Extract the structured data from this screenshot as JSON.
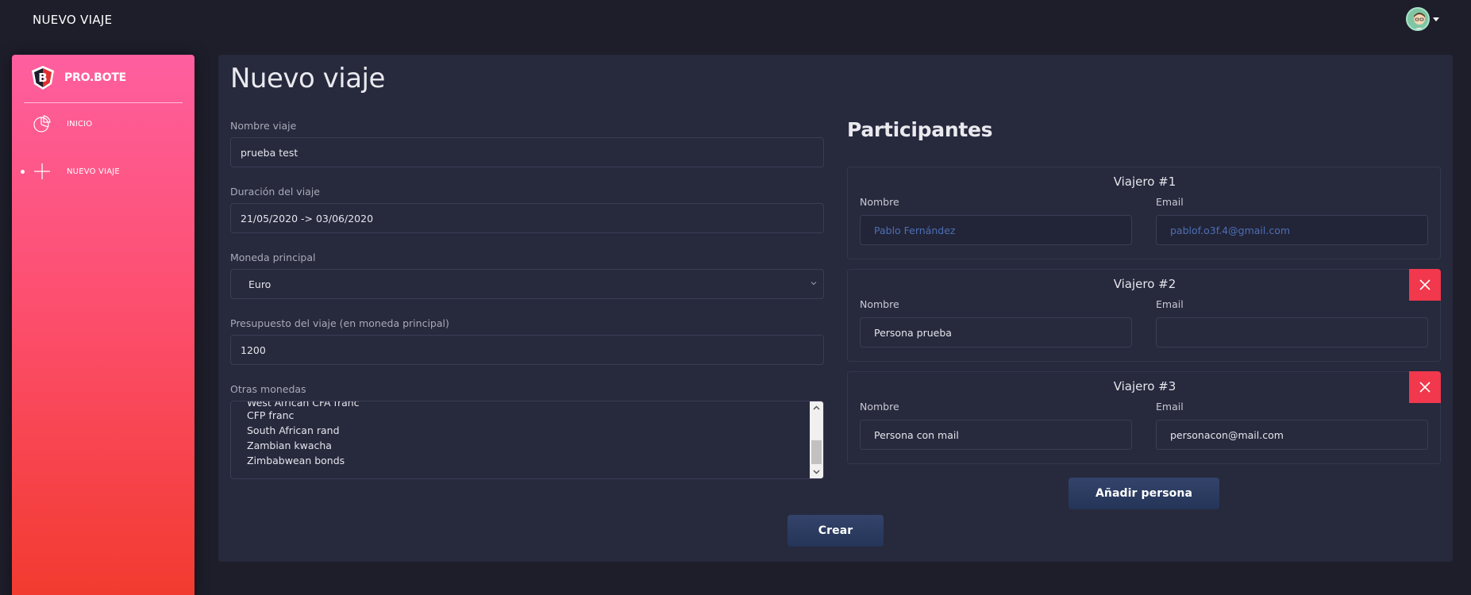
{
  "topbar": {
    "title": "NUEVO VIAJE",
    "avatar_icon": "user-avatar"
  },
  "sidebar": {
    "brand": "PRO.BOTE",
    "items": [
      {
        "label": "INICIO",
        "icon": "pie-chart-icon",
        "active": false
      },
      {
        "label": "NUEVO VIAJE",
        "icon": "plus-icon",
        "active": true
      }
    ]
  },
  "form": {
    "title": "Nuevo viaje",
    "trip_name": {
      "label": "Nombre viaje",
      "value": "prueba test"
    },
    "duration": {
      "label": "Duración del viaje",
      "value": "21/05/2020 -> 03/06/2020"
    },
    "currency": {
      "label": "Moneda principal",
      "value": "Euro"
    },
    "budget": {
      "label": "Presupuesto del viaje (en moneda principal)",
      "value": "1200"
    },
    "other_currencies": {
      "label": "Otras monedas",
      "options": [
        "West African CFA franc",
        "CFP franc",
        "South African rand",
        "Zambian kwacha",
        "Zimbabwean bonds"
      ]
    },
    "create_label": "Crear"
  },
  "participants": {
    "title": "Participantes",
    "name_label": "Nombre",
    "email_label": "Email",
    "travelers": [
      {
        "title": "Viajero #1",
        "name": "Pablo Fernández",
        "email": "pablof.o3f.4@gmail.com",
        "locked": true
      },
      {
        "title": "Viajero #2",
        "name": "Persona prueba",
        "email": "",
        "locked": false
      },
      {
        "title": "Viajero #3",
        "name": "Persona con mail",
        "email": "personacon@mail.com",
        "locked": false
      }
    ],
    "add_label": "Añadir persona"
  },
  "colors": {
    "accent_red": "#f1384c",
    "sidebar_top": "#fe5f9f",
    "sidebar_bottom": "#f23a2e",
    "card_bg": "#27293d",
    "button": "#2b3d61"
  }
}
